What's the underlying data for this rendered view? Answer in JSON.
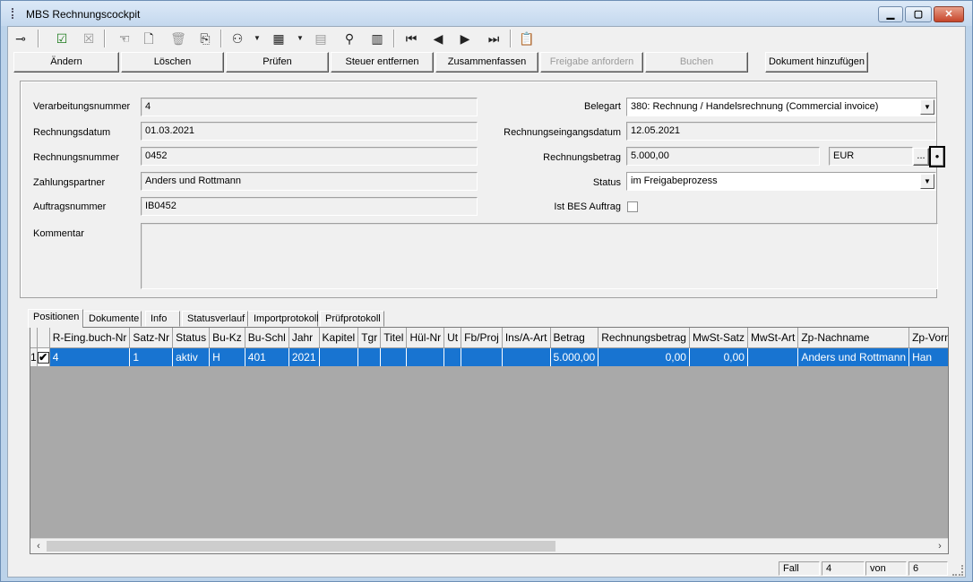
{
  "window": {
    "title": "MBS Rechnungscockpit"
  },
  "toolbar": {
    "icons": [
      "pin-icon",
      "approve-icon",
      "reject-icon",
      "hand-icon",
      "new-document-icon",
      "delete-bin-icon",
      "copy-icon",
      "binoculars-icon",
      "view-icon",
      "grid-icon",
      "find-icon",
      "columns-icon",
      "first-icon",
      "previous-icon",
      "next-icon",
      "last-icon",
      "export-icon"
    ]
  },
  "actions": {
    "aendern": "Ändern",
    "loeschen": "Löschen",
    "pruefen": "Prüfen",
    "steuer": "Steuer entfernen",
    "zusammenfassen": "Zusammenfassen",
    "freigabe": "Freigabe anfordern",
    "buchen": "Buchen",
    "dokument": "Dokument hinzufügen"
  },
  "form": {
    "verarbeitungsnummer": {
      "label": "Verarbeitungsnummer",
      "value": "4"
    },
    "rechnungsdatum": {
      "label": "Rechnungsdatum",
      "value": "01.03.2021"
    },
    "rechnungsnummer": {
      "label": "Rechnungsnummer",
      "value": "0452"
    },
    "zahlungspartner": {
      "label": "Zahlungspartner",
      "value": "Anders und Rottmann"
    },
    "auftragsnummer": {
      "label": "Auftragsnummer",
      "value": "IB0452"
    },
    "kommentar": {
      "label": "Kommentar",
      "value": ""
    },
    "belegart": {
      "label": "Belegart",
      "value": "380: Rechnung / Handelsrechnung (Commercial invoice)"
    },
    "eingangsdatum": {
      "label": "Rechnungseingangsdatum",
      "value": "12.05.2021"
    },
    "betrag": {
      "label": "Rechnungsbetrag",
      "value": "5.000,00",
      "currency": "EUR",
      "more": "..."
    },
    "status": {
      "label": "Status",
      "value": "im Freigabeprozess"
    },
    "bes": {
      "label": "Ist BES Auftrag",
      "checked": false
    }
  },
  "tabs": [
    "Positionen",
    "Dokumente",
    "Info",
    "Statusverlauf",
    "Importprotokoll",
    "Prüfprotokoll"
  ],
  "grid": {
    "columns": [
      "R-Eing.buch-Nr",
      "Satz-Nr",
      "Status",
      "Bu-Kz",
      "Bu-Schl",
      "Jahr",
      "Kapitel",
      "Tgr",
      "Titel",
      "Hül-Nr",
      "Ut",
      "Fb/Proj",
      "Ins/A-Art",
      "Betrag",
      "Rechnungsbetrag",
      "MwSt-Satz",
      "MwSt-Art",
      "Zp-Nachname",
      "Zp-Vorname"
    ],
    "rows": [
      {
        "nr": "1",
        "checked": true,
        "cells": [
          "4",
          "1",
          "aktiv",
          "H",
          "401",
          "2021",
          "",
          "",
          "",
          "",
          "",
          "",
          "",
          "5.000,00",
          "0,00",
          "0,00",
          "",
          "Anders und Rottmann",
          "Han"
        ]
      }
    ]
  },
  "status": {
    "fall_label": "Fall",
    "fall_value": "4",
    "von_label": "von",
    "von_value": "6"
  }
}
